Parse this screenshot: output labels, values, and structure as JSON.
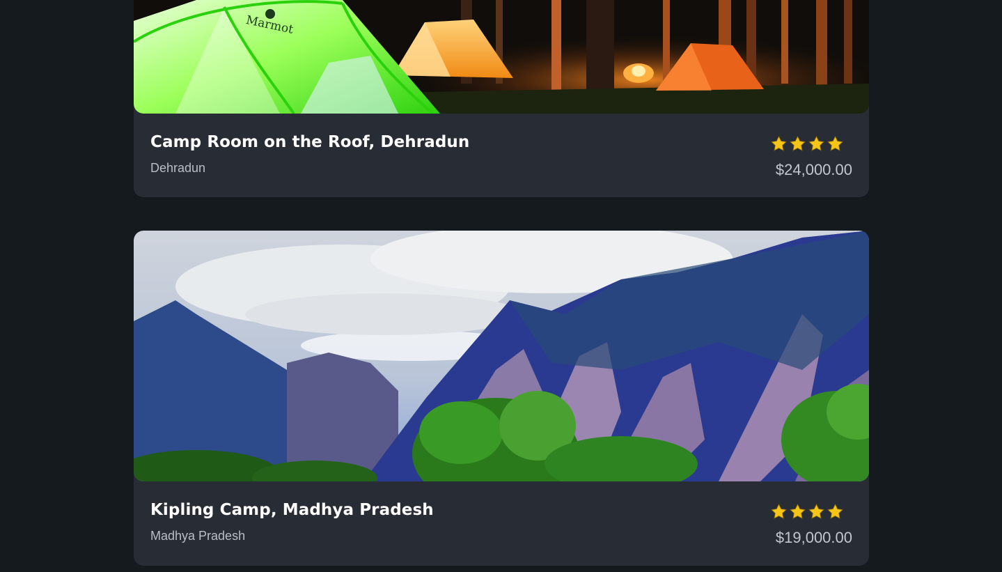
{
  "colors": {
    "page_background": "#141a1e",
    "card_background": "#282c35",
    "title": "#ffffff",
    "subtitle": "#b9bec8",
    "star": "#f5c518"
  },
  "listings": [
    {
      "title": "Camp Room on the Roof, Dehradun",
      "location": "Dehradun",
      "rating": 4,
      "price": "$24,000.00",
      "image_subject": "tents-campfire-forest-night",
      "image_brand_text": "Marmot"
    },
    {
      "title": "Kipling Camp, Madhya Pradesh",
      "location": "Madhya Pradesh",
      "rating": 4,
      "price": "$19,000.00",
      "image_subject": "rocky-mountains-pine-trees"
    }
  ]
}
